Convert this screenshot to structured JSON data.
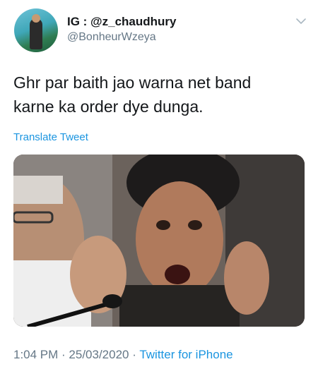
{
  "tweet": {
    "display_name": "IG : @z_chaudhury",
    "handle": "@BonheurWzeya",
    "text": "Ghr par baith jao warna net band\nkarne ka order dye dunga.",
    "translate_label": "Translate Tweet",
    "time": "1:04 PM",
    "separator": " · ",
    "date": "25/03/2020",
    "source": "Twitter for iPhone"
  },
  "colors": {
    "link": "#1b95e0",
    "secondary_text": "#657786",
    "primary_text": "#14171a"
  },
  "icons": {
    "options": "chevron-down-icon"
  }
}
